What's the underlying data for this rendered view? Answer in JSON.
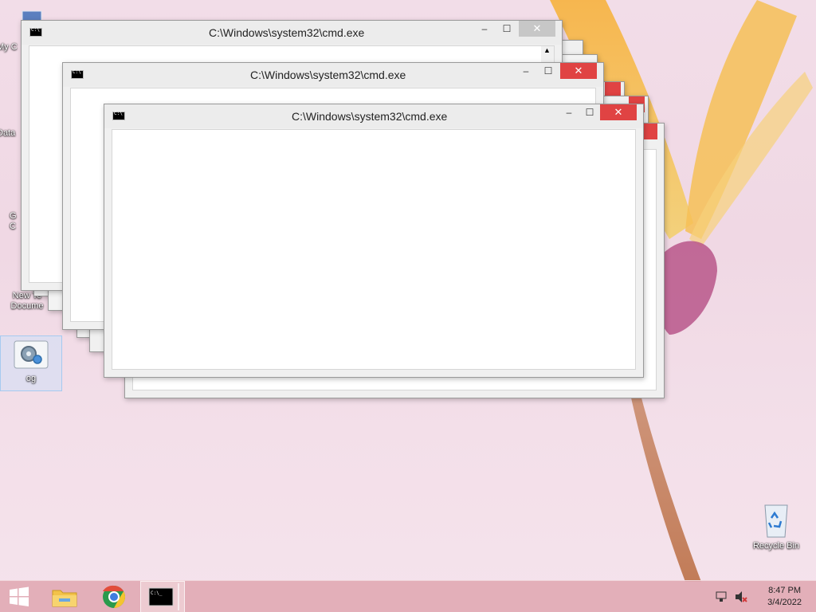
{
  "desktop": {
    "icons": [
      {
        "label": "My C"
      },
      {
        "label": "Data"
      },
      {
        "label": "G\nC"
      },
      {
        "label": "New Te\nDocume"
      },
      {
        "label": "og"
      },
      {
        "label": "Recycle Bin"
      }
    ]
  },
  "windows": [
    {
      "title": "C:\\Windows\\system32\\cmd.exe"
    },
    {
      "title": "C:\\Windows\\system32\\cmd.exe"
    },
    {
      "title": "C:\\Windows\\system32\\cmd.exe"
    }
  ],
  "window_controls": {
    "minimize": "‒",
    "maximize": "☐",
    "close": "✕"
  },
  "taskbar": {
    "clock_time": "8:47 PM",
    "clock_date": "3/4/2022",
    "items": [
      "start-icon",
      "file-explorer-icon",
      "chrome-icon",
      "cmd-icon"
    ]
  },
  "colors": {
    "close_active": "#e04343",
    "close_inactive": "#c7c7c7"
  }
}
